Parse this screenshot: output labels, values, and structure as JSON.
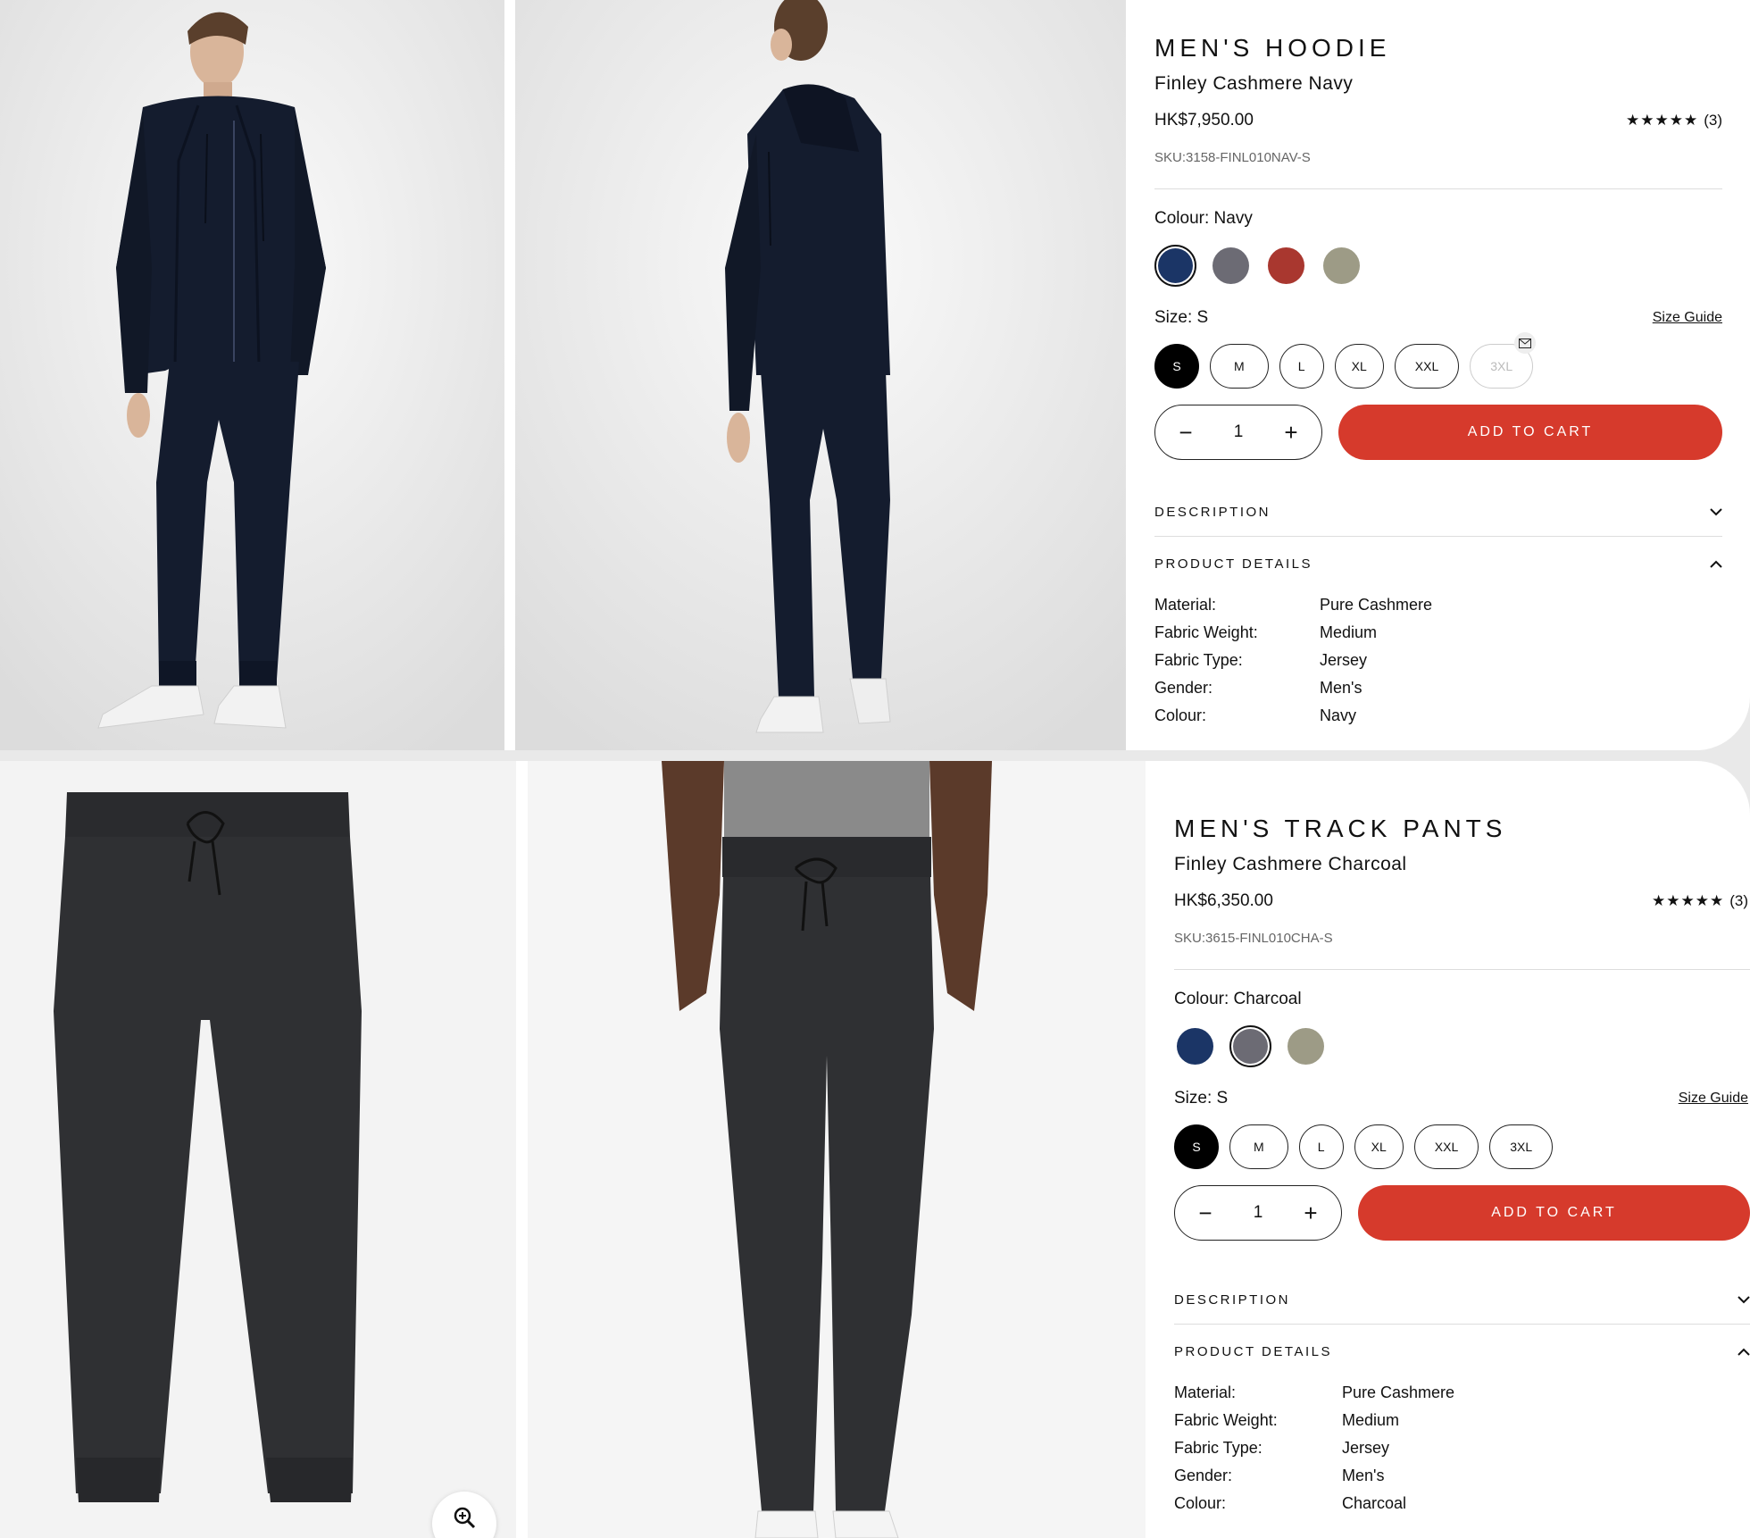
{
  "products": [
    {
      "title": "MEN'S HOODIE",
      "subtitle": "Finley Cashmere Navy",
      "price": "HK$7,950.00",
      "stars": "★★★★★",
      "reviews": "(3)",
      "sku": "SKU:3158-FINL010NAV-S",
      "colour_label": "Colour: Navy",
      "swatches": [
        {
          "color": "#1b3566",
          "selected": true
        },
        {
          "color": "#6c6b74",
          "selected": false
        },
        {
          "color": "#a9372f",
          "selected": false
        },
        {
          "color": "#9d9b86",
          "selected": false
        }
      ],
      "size_label": "Size: S",
      "size_guide": "Size Guide",
      "sizes": [
        "S",
        "M",
        "L",
        "XL",
        "XXL",
        "3XL"
      ],
      "quantity": "1",
      "qty_minus": "−",
      "qty_plus": "+",
      "add_to_cart": "ADD TO CART",
      "description_label": "DESCRIPTION",
      "product_details_label": "PRODUCT DETAILS",
      "details": [
        {
          "key": "Material:",
          "value": "Pure Cashmere"
        },
        {
          "key": "Fabric Weight:",
          "value": "Medium"
        },
        {
          "key": "Fabric Type:",
          "value": "Jersey"
        },
        {
          "key": "Gender:",
          "value": "Men's"
        },
        {
          "key": "Colour:",
          "value": "Navy"
        }
      ]
    },
    {
      "title": "MEN'S TRACK PANTS",
      "subtitle": "Finley Cashmere Charcoal",
      "price": "HK$6,350.00",
      "stars": "★★★★★",
      "reviews": "(3)",
      "sku": "SKU:3615-FINL010CHA-S",
      "colour_label": "Colour: Charcoal",
      "swatches": [
        {
          "color": "#1b3566",
          "selected": false
        },
        {
          "color": "#6c6b74",
          "selected": true
        },
        {
          "color": "#9d9b86",
          "selected": false
        }
      ],
      "size_label": "Size: S",
      "size_guide": "Size Guide",
      "sizes": [
        "S",
        "M",
        "L",
        "XL",
        "XXL",
        "3XL"
      ],
      "quantity": "1",
      "qty_minus": "−",
      "qty_plus": "+",
      "add_to_cart": "ADD TO CART",
      "description_label": "DESCRIPTION",
      "product_details_label": "PRODUCT DETAILS",
      "details": [
        {
          "key": "Material:",
          "value": "Pure Cashmere"
        },
        {
          "key": "Fabric Weight:",
          "value": "Medium"
        },
        {
          "key": "Fabric Type:",
          "value": "Jersey"
        },
        {
          "key": "Gender:",
          "value": "Men's"
        },
        {
          "key": "Colour:",
          "value": "Charcoal"
        }
      ]
    }
  ],
  "icons": {
    "chevron_down": "chevron-down-icon",
    "chevron_up": "chevron-up-icon",
    "zoom": "zoom-in-icon",
    "notify": "envelope-icon"
  },
  "colors": {
    "accent": "#d63a2c",
    "navy": "#141c2e",
    "charcoal": "#2f3033"
  }
}
